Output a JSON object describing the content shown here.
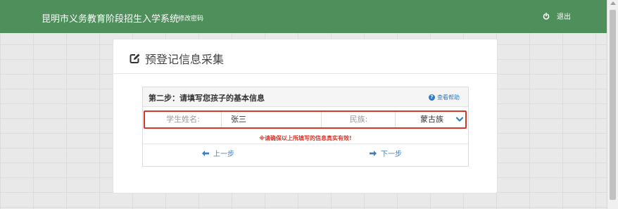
{
  "header": {
    "app_title": "昆明市义务教育阶段招生入学系统",
    "change_password": "修改密码",
    "logout": "退出"
  },
  "panel": {
    "title": "预登记信息采集"
  },
  "form": {
    "step_title": "第二步：请填写您孩子的基本信息",
    "help_link": "查看帮助",
    "help_icon_char": "?",
    "student_name_label": "学生姓名:",
    "student_name_value": "张三",
    "nation_label": "民族:",
    "nation_value": "蒙古族",
    "warning": "※请确保以上所填写的信息真实有效!",
    "prev_button": "上一步",
    "next_button": "下一步"
  },
  "colors": {
    "header_bg": "#4f8f5c",
    "highlight_border": "#d8362b",
    "link_blue": "#2b7cc9",
    "warning_red": "#e1342a"
  }
}
